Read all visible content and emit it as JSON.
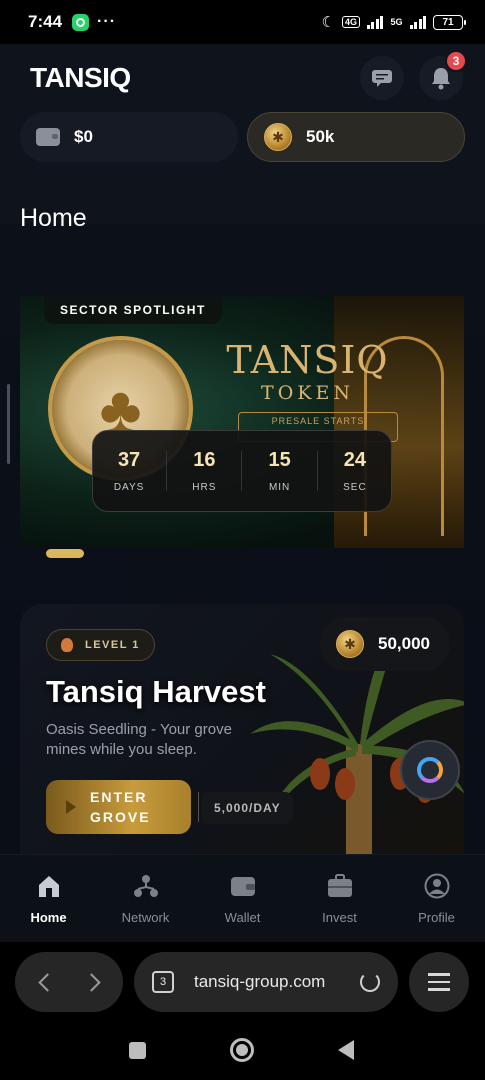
{
  "status_bar": {
    "time": "7:44",
    "battery": "71",
    "network": "5G"
  },
  "header": {
    "brand": "TANSIQ",
    "notification_count": "3"
  },
  "balances": {
    "cash": "$0",
    "coins": "50k"
  },
  "page": {
    "title": "Home"
  },
  "spotlight": {
    "label": "SECTOR SPOTLIGHT",
    "token_title": "TANSIQ",
    "token_sub": "TOKEN",
    "presale": "PRESALE STARTS",
    "countdown": [
      {
        "value": "37",
        "unit": "DAYS"
      },
      {
        "value": "16",
        "unit": "HRS"
      },
      {
        "value": "15",
        "unit": "MIN"
      },
      {
        "value": "24",
        "unit": "SEC"
      }
    ]
  },
  "harvest": {
    "level": "LEVEL 1",
    "coins": "50,000",
    "title": "Tansiq Harvest",
    "description": "Oasis Seedling - Your grove mines while you sleep.",
    "button_line1": "ENTER",
    "button_line2": "GROVE",
    "rate": "5,000/DAY"
  },
  "nav": [
    {
      "label": "Home",
      "icon": "home-icon"
    },
    {
      "label": "Network",
      "icon": "network-icon"
    },
    {
      "label": "Wallet",
      "icon": "wallet-icon"
    },
    {
      "label": "Invest",
      "icon": "briefcase-icon"
    },
    {
      "label": "Profile",
      "icon": "profile-icon"
    }
  ],
  "browser": {
    "tab_count": "3",
    "url": "tansiq-group.com"
  },
  "colors": {
    "accent_gold": "#c89b3c",
    "badge_red": "#e5484d",
    "background": "#0b0f18"
  }
}
